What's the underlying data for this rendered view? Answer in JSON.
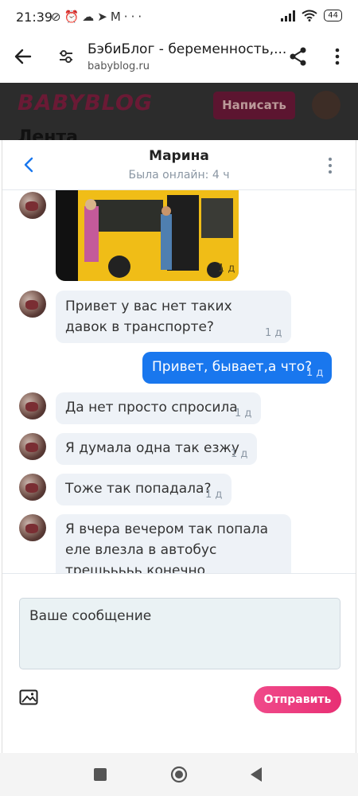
{
  "status_bar": {
    "time": "21:39",
    "left_icons": [
      "mute-icon",
      "alarm-icon",
      "cloud-icon",
      "telegram-icon",
      "gmail-icon",
      "more-dots-icon"
    ],
    "battery": "44"
  },
  "browser": {
    "title": "БэбиБлог - беременность,...",
    "url": "babyblog.ru"
  },
  "background_page": {
    "logo": "BABYBLOG",
    "write_button": "Написать",
    "heading": "Лента"
  },
  "chat": {
    "name": "Марина",
    "status": "Была онлайн: 4 ч",
    "photo_time": "1 д",
    "messages": [
      {
        "dir": "in",
        "lines": [
          "Привет у вас нет таких",
          "давок в транспорте?"
        ],
        "time": "1 д"
      },
      {
        "dir": "out",
        "lines": [
          "Привет, бывает,а что?"
        ],
        "time": "1 д"
      },
      {
        "dir": "in",
        "lines": [
          "Да нет просто спросила"
        ],
        "time": "1 д"
      },
      {
        "dir": "in",
        "lines": [
          "Я думала одна так езжу"
        ],
        "time": "1 д"
      },
      {
        "dir": "in",
        "lines": [
          "Тоже так попадала?"
        ],
        "time": "1 д"
      },
      {
        "dir": "in",
        "lines": [
          "Я вчера вечером так попала",
          "еле влезла в автобус",
          "трешььььь конечно"
        ],
        "time": ""
      }
    ]
  },
  "composer": {
    "placeholder": "Ваше сообщение",
    "send_label": "Отправить"
  },
  "colors": {
    "accent_blue": "#1977ee",
    "send_pink": "#e82f74",
    "incoming_bubble": "#eef2f7"
  }
}
